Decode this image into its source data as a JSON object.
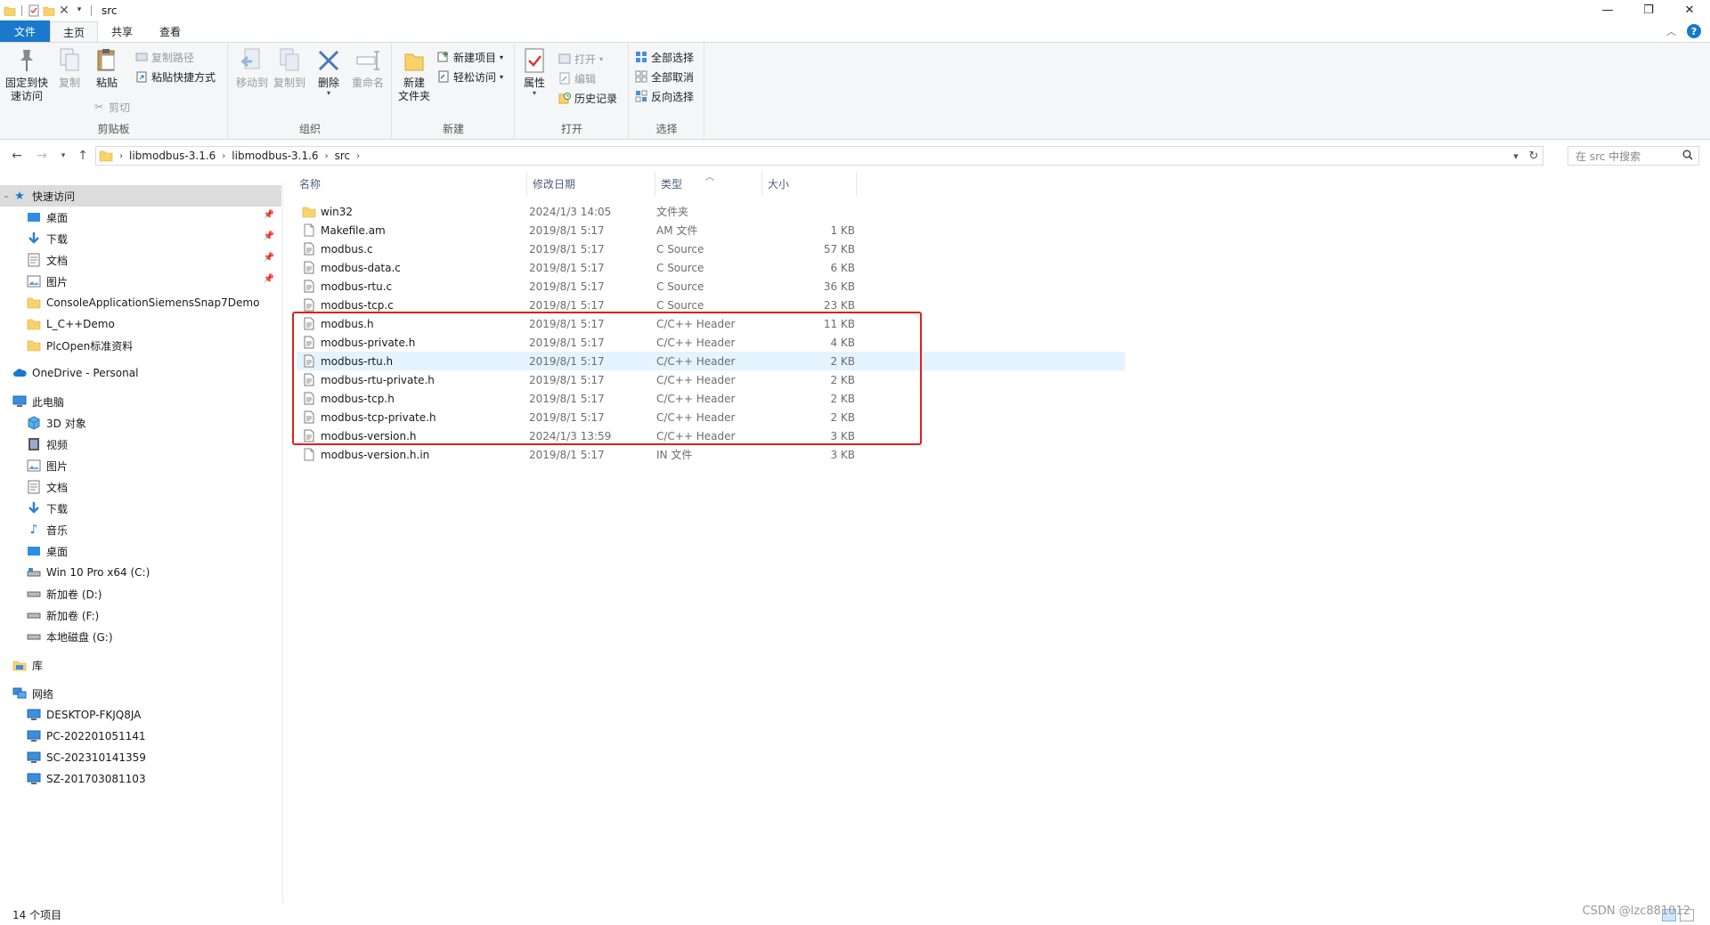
{
  "window": {
    "title": "src",
    "controls": {
      "minimize": "—",
      "maximize": "❐",
      "close": "✕"
    }
  },
  "ribbon_tabs": [
    {
      "label": "文件",
      "kind": "file"
    },
    {
      "label": "主页",
      "kind": "active"
    },
    {
      "label": "共享",
      "kind": "normal"
    },
    {
      "label": "查看",
      "kind": "normal"
    }
  ],
  "ribbon": {
    "clipboard": {
      "label": "剪贴板",
      "pin": "固定到快\n速访问",
      "copy": "复制",
      "paste": "粘贴",
      "copy_path": "复制路径",
      "paste_shortcut": "粘贴快捷方式",
      "cut": "剪切"
    },
    "organize": {
      "label": "组织",
      "move_to": "移动到",
      "copy_to": "复制到",
      "delete": "删除",
      "rename": "重命名"
    },
    "new": {
      "label": "新建",
      "new_folder": "新建\n文件夹",
      "new_item": "新建项目",
      "easy_access": "轻松访问"
    },
    "open": {
      "label": "打开",
      "properties": "属性",
      "open": "打开",
      "edit": "编辑",
      "history": "历史记录"
    },
    "select": {
      "label": "选择",
      "select_all": "全部选择",
      "select_none": "全部取消",
      "invert": "反向选择"
    }
  },
  "address": {
    "crumbs": [
      "libmodbus-3.1.6",
      "libmodbus-3.1.6",
      "src"
    ],
    "search_placeholder": "在 src 中搜索"
  },
  "nav": {
    "quick_access": "快速访问",
    "quick_items": [
      {
        "label": "桌面",
        "icon": "desktop-icon",
        "pinned": true
      },
      {
        "label": "下载",
        "icon": "download-icon",
        "pinned": true
      },
      {
        "label": "文档",
        "icon": "document-icon",
        "pinned": true
      },
      {
        "label": "图片",
        "icon": "picture-icon",
        "pinned": true
      },
      {
        "label": "ConsoleApplicationSiemensSnap7Demo",
        "icon": "folder-icon",
        "pinned": false
      },
      {
        "label": "L_C++Demo",
        "icon": "folder-icon",
        "pinned": false
      },
      {
        "label": "PlcOpen标准资料",
        "icon": "folder-icon",
        "pinned": false
      }
    ],
    "onedrive": "OneDrive - Personal",
    "this_pc": "此电脑",
    "pc_items": [
      {
        "label": "3D 对象",
        "icon": "3d-objects-icon"
      },
      {
        "label": "视频",
        "icon": "video-icon"
      },
      {
        "label": "图片",
        "icon": "picture-icon"
      },
      {
        "label": "文档",
        "icon": "document-icon"
      },
      {
        "label": "下载",
        "icon": "download-icon"
      },
      {
        "label": "音乐",
        "icon": "music-icon"
      },
      {
        "label": "桌面",
        "icon": "desktop-icon"
      },
      {
        "label": "Win 10 Pro x64 (C:)",
        "icon": "system-drive-icon"
      },
      {
        "label": "新加卷 (D:)",
        "icon": "drive-icon"
      },
      {
        "label": "新加卷 (F:)",
        "icon": "drive-icon"
      },
      {
        "label": "本地磁盘 (G:)",
        "icon": "drive-icon"
      }
    ],
    "library": "库",
    "network": "网络",
    "network_items": [
      {
        "label": "DESKTOP-FKJQ8JA"
      },
      {
        "label": "PC-202201051141"
      },
      {
        "label": "SC-202310141359"
      },
      {
        "label": "SZ-201703081103"
      }
    ]
  },
  "columns": {
    "name": "名称",
    "date": "修改日期",
    "type": "类型",
    "size": "大小"
  },
  "files": [
    {
      "name": "win32",
      "date": "2024/1/3 14:05",
      "type": "文件夹",
      "size": "",
      "icon": "folder-icon"
    },
    {
      "name": "Makefile.am",
      "date": "2019/8/1 5:17",
      "type": "AM 文件",
      "size": "1 KB",
      "icon": "file-icon"
    },
    {
      "name": "modbus.c",
      "date": "2019/8/1 5:17",
      "type": "C Source",
      "size": "57 KB",
      "icon": "c-source-file-icon"
    },
    {
      "name": "modbus-data.c",
      "date": "2019/8/1 5:17",
      "type": "C Source",
      "size": "6 KB",
      "icon": "c-source-file-icon"
    },
    {
      "name": "modbus-rtu.c",
      "date": "2019/8/1 5:17",
      "type": "C Source",
      "size": "36 KB",
      "icon": "c-source-file-icon"
    },
    {
      "name": "modbus-tcp.c",
      "date": "2019/8/1 5:17",
      "type": "C Source",
      "size": "23 KB",
      "icon": "c-source-file-icon"
    },
    {
      "name": "modbus.h",
      "date": "2019/8/1 5:17",
      "type": "C/C++ Header",
      "size": "11 KB",
      "icon": "header-file-icon"
    },
    {
      "name": "modbus-private.h",
      "date": "2019/8/1 5:17",
      "type": "C/C++ Header",
      "size": "4 KB",
      "icon": "header-file-icon"
    },
    {
      "name": "modbus-rtu.h",
      "date": "2019/8/1 5:17",
      "type": "C/C++ Header",
      "size": "2 KB",
      "icon": "header-file-icon"
    },
    {
      "name": "modbus-rtu-private.h",
      "date": "2019/8/1 5:17",
      "type": "C/C++ Header",
      "size": "2 KB",
      "icon": "header-file-icon"
    },
    {
      "name": "modbus-tcp.h",
      "date": "2019/8/1 5:17",
      "type": "C/C++ Header",
      "size": "2 KB",
      "icon": "header-file-icon"
    },
    {
      "name": "modbus-tcp-private.h",
      "date": "2019/8/1 5:17",
      "type": "C/C++ Header",
      "size": "2 KB",
      "icon": "header-file-icon"
    },
    {
      "name": "modbus-version.h",
      "date": "2024/1/3 13:59",
      "type": "C/C++ Header",
      "size": "3 KB",
      "icon": "header-file-icon"
    },
    {
      "name": "modbus-version.h.in",
      "date": "2019/8/1 5:17",
      "type": "IN 文件",
      "size": "3 KB",
      "icon": "file-icon"
    }
  ],
  "hovered_row": "modbus-rtu.h",
  "status": {
    "item_count": "14 个项目"
  },
  "watermark": "CSDN @lzc881012",
  "colors": {
    "accent": "#1979ca",
    "highlight_box": "#e01e1e",
    "hover": "#e5f3ff",
    "selected": "#dcdcdc"
  }
}
